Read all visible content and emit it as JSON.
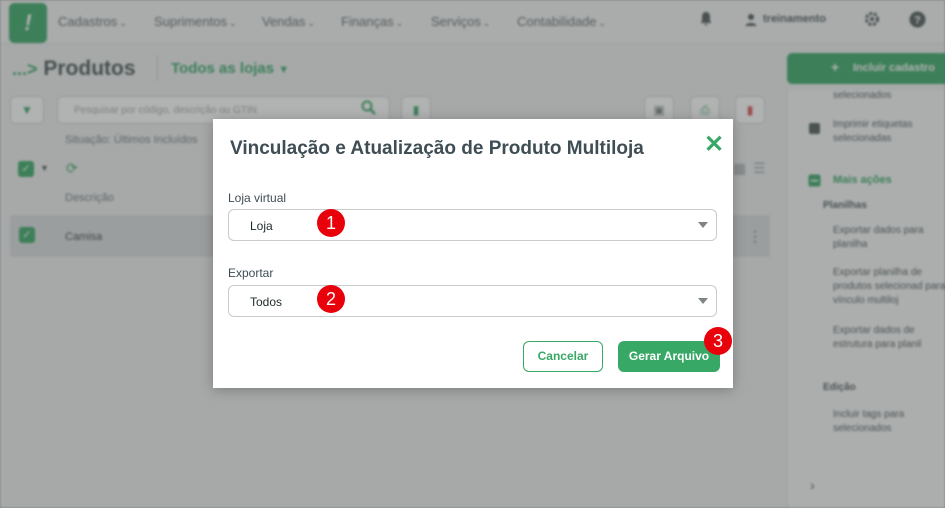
{
  "topbar": {
    "menu": [
      "Cadastros",
      "Suprimentos",
      "Vendas",
      "Finanças",
      "Serviços",
      "Contabilidade"
    ],
    "user_name": "treinamento",
    "icons": [
      "bell-icon",
      "user-icon",
      "gear-icon",
      "help-icon"
    ]
  },
  "page": {
    "breadcrumb_prefix": "...",
    "title": "Produtos",
    "store_filter": "Todos as lojas",
    "include_button": "Incluir cadastro",
    "search_placeholder": "Pesquisar por código, descrição ou GTIN",
    "situation": "Situação: Últimos Incluídos",
    "column_description": "Descrição",
    "rows": [
      {
        "description": "Camisa"
      }
    ]
  },
  "sidebar": {
    "item_selected_tail": "selecionados",
    "print_labels": "Imprimir etiquetas selecionadas",
    "more_actions": "Mais ações",
    "group_spreadsheets": "Planilhas",
    "export_spreadsheet": "Exportar dados para planilha",
    "export_selected": "Exportar planilha de produtos selecionad para vínculo multiloj",
    "export_structure": "Exportar dados de estrutura para planil",
    "group_edit": "Edição",
    "include_tags": "Incluir tags para selecionados"
  },
  "modal": {
    "title": "Vinculação e Atualização de Produto Multiloja",
    "store_label": "Loja virtual",
    "store_value": "Loja",
    "export_label": "Exportar",
    "export_value": "Todos",
    "cancel_label": "Cancelar",
    "generate_label": "Gerar Arquivo"
  },
  "markers": [
    "1",
    "2",
    "3"
  ],
  "colors": {
    "accent": "#38a866",
    "marker": "#e8000b",
    "title_text": "#3f4d55"
  }
}
